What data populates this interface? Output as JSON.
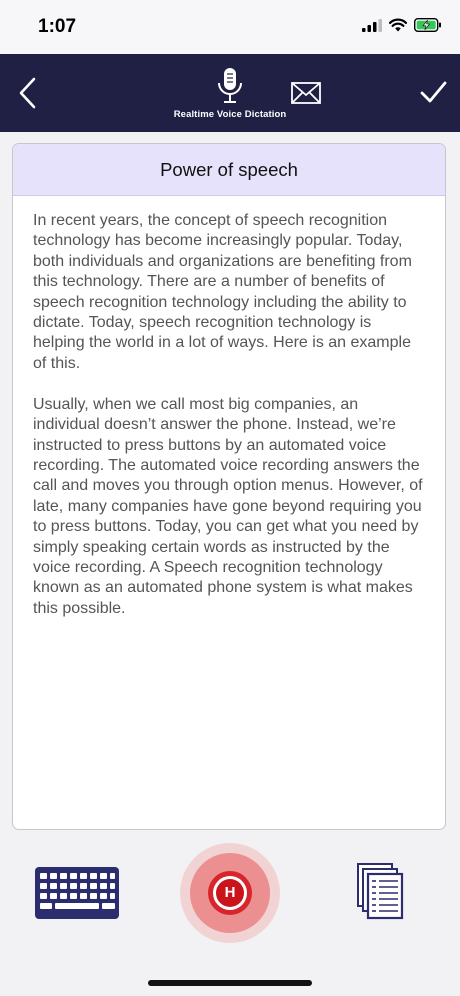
{
  "status_bar": {
    "time": "1:07",
    "icons": [
      "signal-icon",
      "wifi-icon",
      "battery-charging-icon"
    ]
  },
  "navbar": {
    "caption": "Realtime Voice Dictation",
    "background": "#1f2044",
    "icons": [
      "back-chevron-icon",
      "microphone-icon",
      "mail-icon",
      "checkmark-icon"
    ]
  },
  "document": {
    "title": "Power of speech",
    "title_bar_color": "#e6e2fb",
    "paragraphs": [
      "In recent years, the concept of speech recognition technology has become increasingly popular. Today, both individuals and organizations are benefiting from this technology. There are a number of benefits of speech recognition technology including the ability to dictate. Today, speech recognition technology is helping the world in a lot of ways. Here is an example of this.",
      "Usually, when we call most big companies, an individual doesn’t answer the phone. Instead, we’re instructed to press buttons by an automated voice recording. The automated voice recording answers the call and moves you through option menus. However, of late, many companies have gone beyond requiring you to press buttons. Today, you can get what you need by simply speaking certain words as instructed by the voice recording. A Speech recognition technology known as an automated phone system is what makes this possible."
    ]
  },
  "toolbar": {
    "record_letter": "H",
    "record_color": "#d6262b",
    "icons": [
      "keyboard-icon",
      "record-icon",
      "documents-icon"
    ]
  }
}
